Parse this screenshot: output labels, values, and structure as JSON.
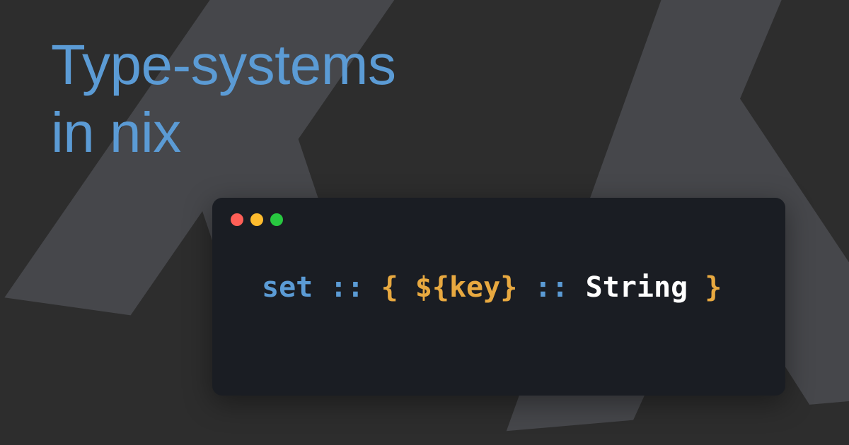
{
  "title": {
    "line1": "Type-systems",
    "line2": "in nix"
  },
  "code": {
    "tokens": {
      "set": "set",
      "dcolon1": "::",
      "lbrace": "{",
      "interp_open": "${",
      "key": "key",
      "interp_close": "}",
      "dcolon2": "::",
      "string_type": "String",
      "rbrace": "}"
    }
  },
  "colors": {
    "background": "#2d2d2d",
    "accent_blue": "#5b9bd5",
    "code_bg": "#1a1d23",
    "shape_gray": "#48494d",
    "token_yellow": "#e8a940",
    "token_white": "#ffffff",
    "dot_red": "#ff5f57",
    "dot_yellow": "#febc2e",
    "dot_green": "#28c840"
  }
}
